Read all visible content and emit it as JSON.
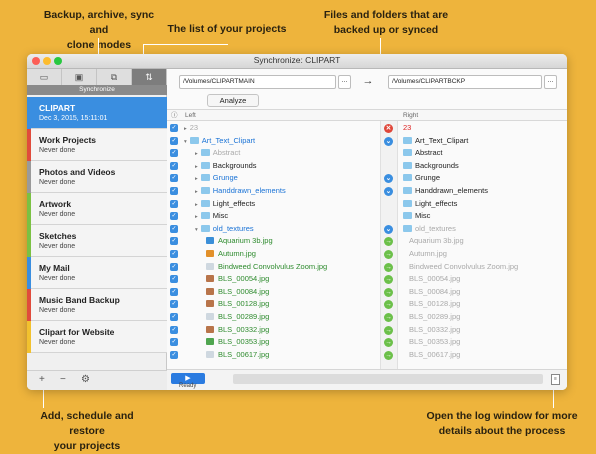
{
  "callouts": {
    "modes_line1": "Backup, archive, sync and",
    "modes_line2": "clone modes",
    "projects_list": "The list of your projects",
    "files_line1": "Files and folders that are",
    "files_line2": "backed up or synced",
    "add_line1": "Add, schedule and restore",
    "add_line2": "your projects",
    "log_line1": "Open the log window for more",
    "log_line2": "details about the process"
  },
  "window": {
    "title": "Synchronize: CLIPART"
  },
  "toolbar": {
    "active_label": "Synchronize",
    "tabs": [
      "backup-icon",
      "archive-icon",
      "clone-icon",
      "sync-icon"
    ]
  },
  "projects": [
    {
      "name": "CLIPART",
      "status": "Dec 3, 2015, 15:11:01",
      "color": "#3A8EE0"
    },
    {
      "name": "Work Projects",
      "status": "Never done",
      "color": "#E04B3C"
    },
    {
      "name": "Photos and Videos",
      "status": "Never done",
      "color": "#9A9A9A"
    },
    {
      "name": "Artwork",
      "status": "Never done",
      "color": "#7BC143"
    },
    {
      "name": "Sketches",
      "status": "Never done",
      "color": "#7BC143"
    },
    {
      "name": "My Mail",
      "status": "Never done",
      "color": "#3A8EE0"
    },
    {
      "name": "Music Band Backup",
      "status": "Never done",
      "color": "#E04B3C"
    },
    {
      "name": "Clipart for Website",
      "status": "Never done",
      "color": "#F2C12E"
    }
  ],
  "sidebar_bottom": {
    "add": "+",
    "remove": "−",
    "settings": "⚙"
  },
  "paths": {
    "left": "/Volumes/CLIPARTMAIN",
    "right": "/Volumes/CLIPARTBCKP",
    "browse": "...",
    "direction": "→"
  },
  "analyze_label": "Analyze",
  "columns": {
    "left": "Left",
    "right": "Right"
  },
  "rows": [
    {
      "indent": 0,
      "tri": "▸",
      "kind": "none",
      "left": "23",
      "lc": "c-grey",
      "sym": "✕",
      "sc": "#e0473a",
      "right": "23",
      "rc": "c-red",
      "rkind": "none"
    },
    {
      "indent": 0,
      "tri": "▾",
      "kind": "folder",
      "left": "Art_Text_Clipart",
      "lc": "c-blue",
      "sym": "⌄",
      "sc": "#3A8EE0",
      "right": "Art_Text_Clipart",
      "rc": "c-dark",
      "rkind": "folder"
    },
    {
      "indent": 1,
      "tri": "▸",
      "kind": "folder",
      "left": "Abstract",
      "lc": "c-grey",
      "sym": "",
      "sc": "",
      "right": "Abstract",
      "rc": "c-dark",
      "rkind": "folder"
    },
    {
      "indent": 1,
      "tri": "▸",
      "kind": "folder",
      "left": "Backgrounds",
      "lc": "c-dark",
      "sym": "",
      "sc": "",
      "right": "Backgrounds",
      "rc": "c-dark",
      "rkind": "folder"
    },
    {
      "indent": 1,
      "tri": "▸",
      "kind": "folder",
      "left": "Grunge",
      "lc": "c-blue",
      "sym": "⌄",
      "sc": "#3A8EE0",
      "right": "Grunge",
      "rc": "c-dark",
      "rkind": "folder"
    },
    {
      "indent": 1,
      "tri": "▸",
      "kind": "folder",
      "left": "Handdrawn_elements",
      "lc": "c-blue",
      "sym": "⌄",
      "sc": "#3A8EE0",
      "right": "Handdrawn_elements",
      "rc": "c-dark",
      "rkind": "folder"
    },
    {
      "indent": 1,
      "tri": "▸",
      "kind": "folder",
      "left": "Light_effects",
      "lc": "c-dark",
      "sym": "",
      "sc": "",
      "right": "Light_effects",
      "rc": "c-dark",
      "rkind": "folder"
    },
    {
      "indent": 1,
      "tri": "▸",
      "kind": "folder",
      "left": "Misc",
      "lc": "c-dark",
      "sym": "",
      "sc": "",
      "right": "Misc",
      "rc": "c-dark",
      "rkind": "folder"
    },
    {
      "indent": 1,
      "tri": "▾",
      "kind": "folder",
      "left": "old_textures",
      "lc": "c-blue",
      "sym": "⌄",
      "sc": "#3A8EE0",
      "right": "old_textures",
      "rc": "c-grey",
      "rkind": "folder"
    },
    {
      "indent": 2,
      "tri": "",
      "kind": "img-blue",
      "left": "Aquarium 3b.jpg",
      "lc": "c-green",
      "sym": "→",
      "sc": "#6cc04a",
      "right": "Aquarium 3b.jpg",
      "rc": "c-grey",
      "rkind": "none"
    },
    {
      "indent": 2,
      "tri": "",
      "kind": "img-orange",
      "left": "Autumn.jpg",
      "lc": "c-green",
      "sym": "→",
      "sc": "#6cc04a",
      "right": "Autumn.jpg",
      "rc": "c-grey",
      "rkind": "none"
    },
    {
      "indent": 2,
      "tri": "",
      "kind": "img-doc",
      "left": "Bindweed Convolvulus Zoom.jpg",
      "lc": "c-green",
      "sym": "→",
      "sc": "#6cc04a",
      "right": "Bindweed Convolvulus Zoom.jpg",
      "rc": "c-grey",
      "rkind": "none"
    },
    {
      "indent": 2,
      "tri": "",
      "kind": "img-brown",
      "left": "BLS_00054.jpg",
      "lc": "c-green",
      "sym": "→",
      "sc": "#6cc04a",
      "right": "BLS_00054.jpg",
      "rc": "c-grey",
      "rkind": "none"
    },
    {
      "indent": 2,
      "tri": "",
      "kind": "img-brown",
      "left": "BLS_00084.jpg",
      "lc": "c-green",
      "sym": "→",
      "sc": "#6cc04a",
      "right": "BLS_00084.jpg",
      "rc": "c-grey",
      "rkind": "none"
    },
    {
      "indent": 2,
      "tri": "",
      "kind": "img-brown",
      "left": "BLS_00128.jpg",
      "lc": "c-green",
      "sym": "→",
      "sc": "#6cc04a",
      "right": "BLS_00128.jpg",
      "rc": "c-grey",
      "rkind": "none"
    },
    {
      "indent": 2,
      "tri": "",
      "kind": "img-doc",
      "left": "BLS_00289.jpg",
      "lc": "c-green",
      "sym": "→",
      "sc": "#6cc04a",
      "right": "BLS_00289.jpg",
      "rc": "c-grey",
      "rkind": "none"
    },
    {
      "indent": 2,
      "tri": "",
      "kind": "img-brown",
      "left": "BLS_00332.jpg",
      "lc": "c-green",
      "sym": "→",
      "sc": "#6cc04a",
      "right": "BLS_00332.jpg",
      "rc": "c-grey",
      "rkind": "none"
    },
    {
      "indent": 2,
      "tri": "",
      "kind": "img-green",
      "left": "BLS_00353.jpg",
      "lc": "c-green",
      "sym": "→",
      "sc": "#6cc04a",
      "right": "BLS_00353.jpg",
      "rc": "c-grey",
      "rkind": "none"
    },
    {
      "indent": 2,
      "tri": "",
      "kind": "img-doc",
      "left": "BLS_00617.jpg",
      "lc": "c-green",
      "sym": "→",
      "sc": "#6cc04a",
      "right": "BLS_00617.jpg",
      "rc": "c-grey",
      "rkind": "none"
    }
  ],
  "bottom": {
    "play": "▶",
    "status": "Ready",
    "log_icon": "document-icon"
  },
  "colors": {
    "background": "#EEB43C",
    "accent": "#3A8EE0",
    "play": "#2a7be0"
  }
}
